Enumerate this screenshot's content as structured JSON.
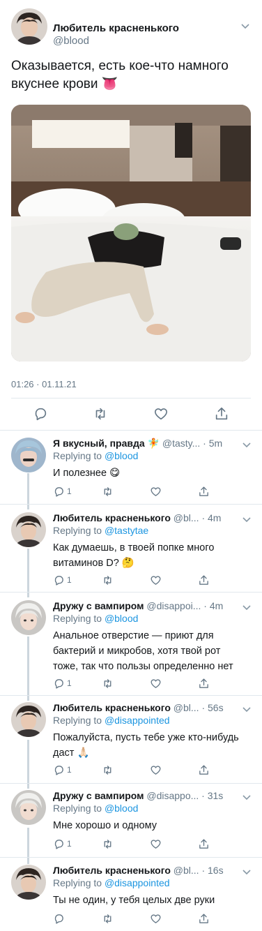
{
  "main_tweet": {
    "author_name": "Любитель красненького",
    "author_handle": "@blood",
    "text": "Оказывается, есть кое-что намного вкуснее крови 👅",
    "timestamp": "01:26 · 01.11.21"
  },
  "replies": [
    {
      "name": "Я вкусный, правда 🧚",
      "meta": "@tasty... · 5m",
      "replying_prefix": "Replying to",
      "replying_to": "@blood",
      "text": "И полезнее 😋",
      "reply_count": "1"
    },
    {
      "name": "Любитель красненького",
      "meta": "@bl... · 4m",
      "replying_prefix": "Replying to",
      "replying_to": "@tastytae",
      "text": "Как думаешь, в твоей попке много витаминов D? 🤔",
      "reply_count": "1"
    },
    {
      "name": "Дружу с вампиром",
      "meta": "@disappoi... · 4m",
      "replying_prefix": "Replying to",
      "replying_to": "@blood",
      "text": "Анальное отверстие — приют для бактерий и микробов, хотя твой рот тоже, так что пользы определенно нет",
      "reply_count": "1"
    },
    {
      "name": "Любитель красненького",
      "meta": "@bl... · 56s",
      "replying_prefix": "Replying to",
      "replying_to": "@disappointed",
      "text": "Пожалуйста, пусть тебе уже кто-нибудь даст 🙏🏻",
      "reply_count": "1"
    },
    {
      "name": "Дружу с вампиром",
      "meta": "@disappo... · 31s",
      "replying_prefix": "Replying to",
      "replying_to": "@blood",
      "text": "Мне хорошо и одному",
      "reply_count": "1"
    },
    {
      "name": "Любитель красненького",
      "meta": "@bl... · 16s",
      "replying_prefix": "Replying to",
      "replying_to": "@disappointed",
      "text": "Ты не один, у тебя целых две руки",
      "reply_count": ""
    }
  ],
  "icons": {
    "reply": "reply-icon",
    "retweet": "retweet-icon",
    "like": "like-icon",
    "share": "share-icon",
    "more": "chevron-down-icon"
  },
  "colors": {
    "link": "#1b95e0",
    "secondary_text": "#657786",
    "divider": "#e1e8ed",
    "thread_line": "#ccd6dd"
  }
}
